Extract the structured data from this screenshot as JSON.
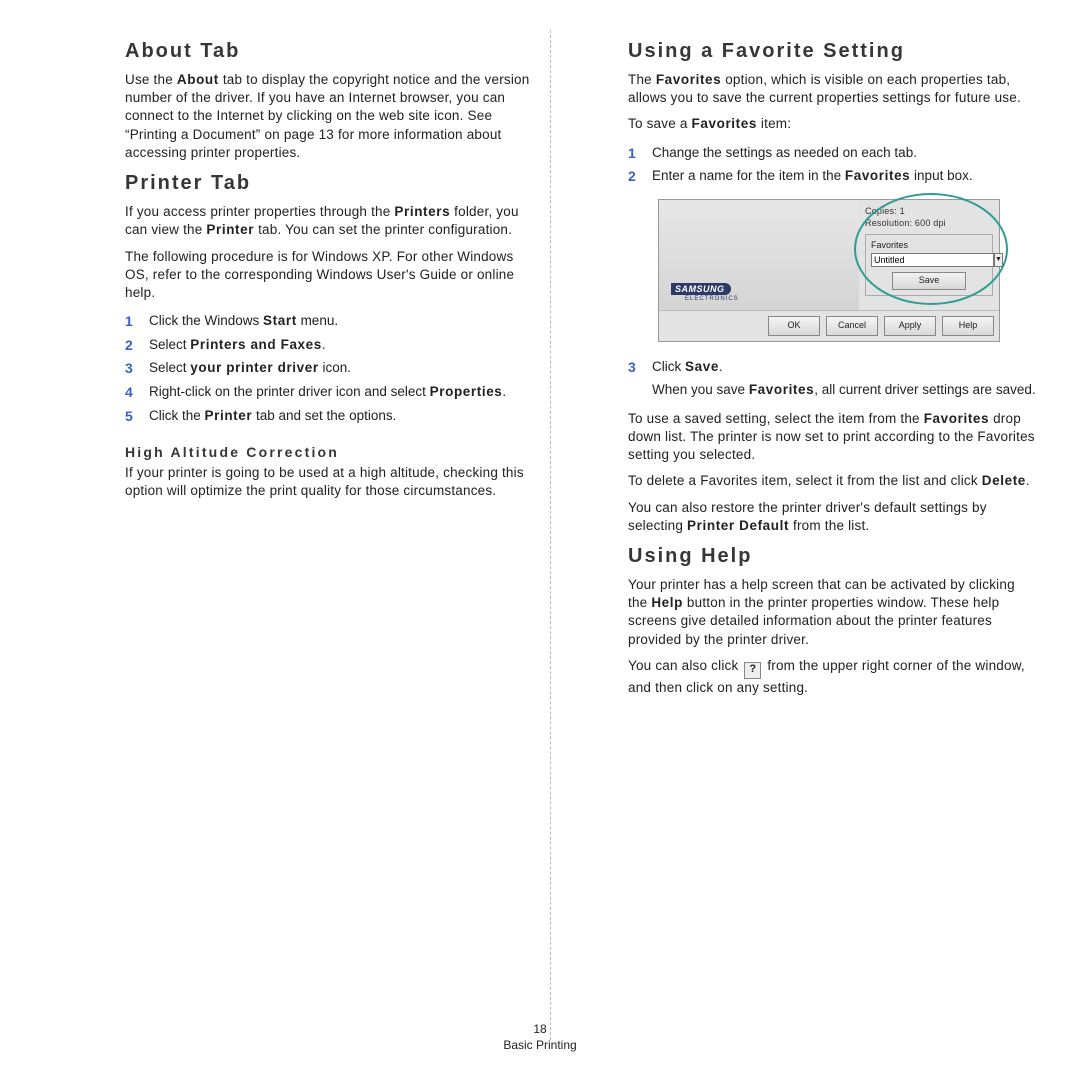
{
  "footer": {
    "page_number": "18",
    "section": "Basic Printing"
  },
  "left": {
    "about": {
      "heading": "About Tab",
      "p1_a": "Use the ",
      "p1_b": "About",
      "p1_c": " tab to display the copyright notice and the version number of the driver. If you have an Internet browser, you can connect to the Internet by clicking on the web site icon. See “Printing a Document” on page 13 for more information about accessing printer properties."
    },
    "printer": {
      "heading": "Printer Tab",
      "p1_a": "If you access printer properties through the ",
      "p1_b": "Printers",
      "p1_c": " folder, you can view the ",
      "p1_d": "Printer",
      "p1_e": " tab. You can set the printer configuration.",
      "p2": "The following procedure is for Windows XP. For other Windows OS, refer to the corresponding Windows User's Guide or online help.",
      "steps": [
        {
          "n": "1",
          "a": "Click the Windows ",
          "b": "Start",
          "c": " menu."
        },
        {
          "n": "2",
          "a": "Select ",
          "b": "Printers and Faxes",
          "c": "."
        },
        {
          "n": "3",
          "a": "Select ",
          "b": "your printer driver",
          "c": " icon."
        },
        {
          "n": "4",
          "a": "Right-click on the printer driver icon and select ",
          "b": "Properties",
          "c": "."
        },
        {
          "n": "5",
          "a": "Click the ",
          "b": "Printer",
          "c": " tab and set the options."
        }
      ],
      "alt_heading": "High Altitude Correction",
      "alt_p": "If your printer is going to be used at a high altitude, checking this option will optimize the print quality for those circumstances."
    }
  },
  "right": {
    "fav": {
      "heading": "Using a Favorite Setting",
      "p1_a": "The ",
      "p1_b": "Favorites",
      "p1_c": " option, which is visible on each properties tab, allows you to save the current properties settings for future use.",
      "p2_a": "To save a ",
      "p2_b": "Favorites",
      "p2_c": " item:",
      "pre_steps": [
        {
          "n": "1",
          "t": "Change the settings as needed on each tab."
        },
        {
          "n": "2",
          "a": "Enter a name for the item in the ",
          "b": "Favorites",
          "c": " input box."
        }
      ],
      "step3": {
        "n": "3",
        "a": "Click ",
        "b": "Save",
        "c": ".",
        "extra_a": "When you save ",
        "extra_b": "Favorites",
        "extra_c": ", all current driver settings are saved."
      },
      "p4_a": "To use a saved setting, select the item from the ",
      "p4_b": "Favorites",
      "p4_c": " drop down list. The printer is now set to print according to the Favorites setting you selected.",
      "p5_a": "To delete a Favorites item, select it from the list and click ",
      "p5_b": "Delete",
      "p5_c": ".",
      "p6_a": "You can also restore the printer driver's default settings by selecting ",
      "p6_b": "Printer Default",
      "p6_c": " from the list."
    },
    "help": {
      "heading": "Using Help",
      "p1_a": "Your printer has a help screen that can be activated by clicking the ",
      "p1_b": "Help",
      "p1_c": " button in the printer properties window. These help screens give detailed information about the printer features provided by the printer driver.",
      "p2_a": "You can also click ",
      "p2_b": " from the upper right corner of the window, and then click on any setting."
    }
  },
  "dialog": {
    "copies_label": "Copies: 1",
    "resolution_label": "Resolution: 600 dpi",
    "fav_label": "Favorites",
    "fav_input": "Untitled",
    "save_btn": "Save",
    "brand": "SAMSUNG",
    "brand_sub": "ELECTRONICS",
    "buttons": [
      "OK",
      "Cancel",
      "Apply",
      "Help"
    ]
  },
  "icons": {
    "help_q": "?"
  }
}
